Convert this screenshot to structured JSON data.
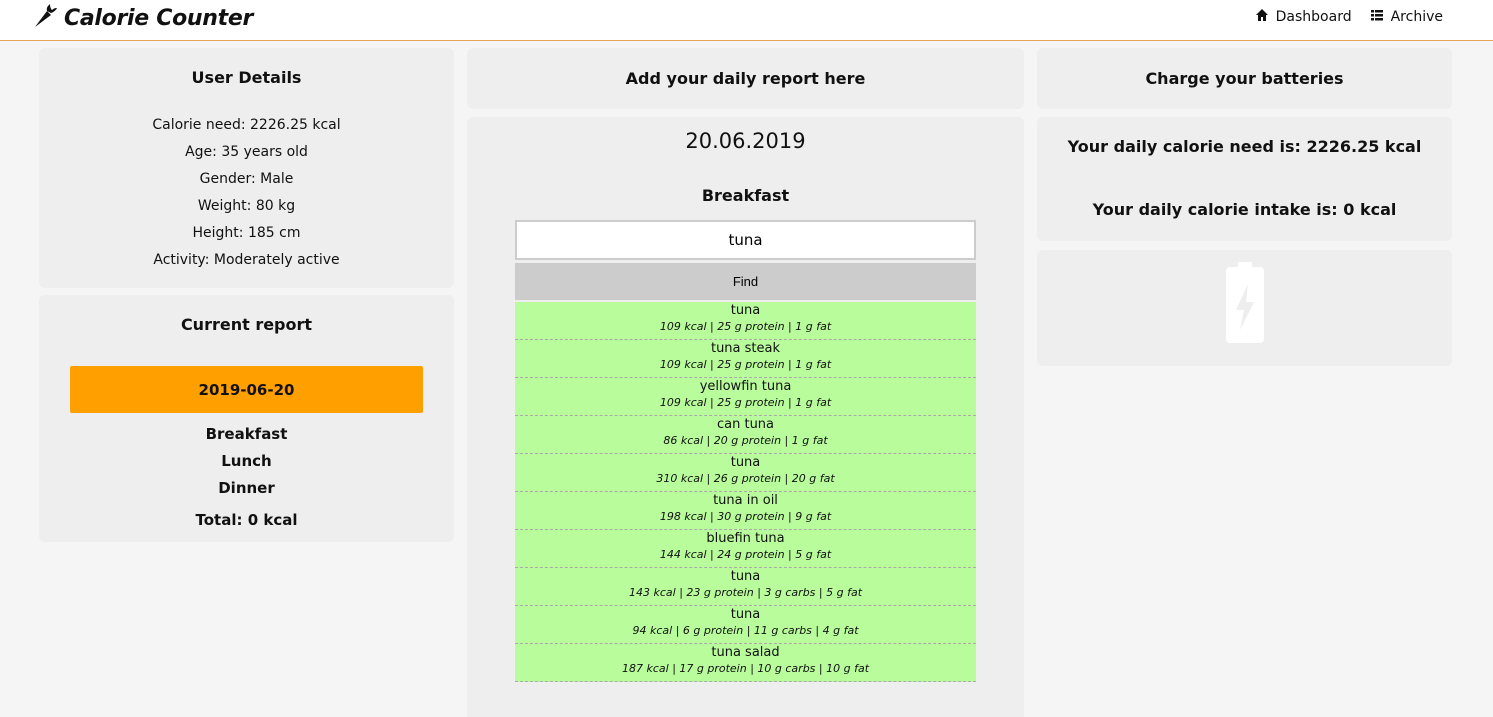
{
  "app": {
    "title": "Calorie Counter"
  },
  "nav": {
    "dashboard": "Dashboard",
    "archive": "Archive"
  },
  "user": {
    "title": "User Details",
    "calorie_need": "Calorie need: 2226.25 kcal",
    "age": "Age: 35 years old",
    "gender": "Gender: Male",
    "weight": "Weight: 80 kg",
    "height": "Height: 185 cm",
    "activity": "Activity: Moderately active"
  },
  "report": {
    "title": "Current report",
    "date": "2019-06-20",
    "meals": [
      "Breakfast",
      "Lunch",
      "Dinner"
    ],
    "total": "Total: 0 kcal"
  },
  "entry": {
    "header": "Add your daily report here",
    "date": "20.06.2019",
    "meal": "Breakfast",
    "search_value": "tuna",
    "find_label": "Find",
    "results": [
      {
        "name": "tuna",
        "info": "109 kcal | 25 g protein | 1 g fat"
      },
      {
        "name": "tuna steak",
        "info": "109 kcal | 25 g protein | 1 g fat"
      },
      {
        "name": "yellowfin tuna",
        "info": "109 kcal | 25 g protein | 1 g fat"
      },
      {
        "name": "can tuna",
        "info": "86 kcal | 20 g protein | 1 g fat"
      },
      {
        "name": "tuna",
        "info": "310 kcal | 26 g protein | 20 g fat"
      },
      {
        "name": "tuna in oil",
        "info": "198 kcal | 30 g protein | 9 g fat"
      },
      {
        "name": "bluefin tuna",
        "info": "144 kcal | 24 g protein | 5 g fat"
      },
      {
        "name": "tuna",
        "info": "143 kcal | 23 g protein | 3 g carbs | 5 g fat"
      },
      {
        "name": "tuna",
        "info": "94 kcal | 6 g protein | 11 g carbs | 4 g fat"
      },
      {
        "name": "tuna salad",
        "info": "187 kcal | 17 g protein | 10 g carbs | 10 g fat"
      }
    ]
  },
  "charge": {
    "title": "Charge your batteries",
    "need": "Your daily calorie need is: 2226.25 kcal",
    "intake": "Your daily calorie intake is: 0 kcal",
    "battery_icon": "battery-charging-icon"
  },
  "colors": {
    "accent": "#ffa000",
    "result_bg": "#b8fc9c",
    "card_bg": "#eeeeee",
    "navbar_border": "#e8a35a"
  }
}
